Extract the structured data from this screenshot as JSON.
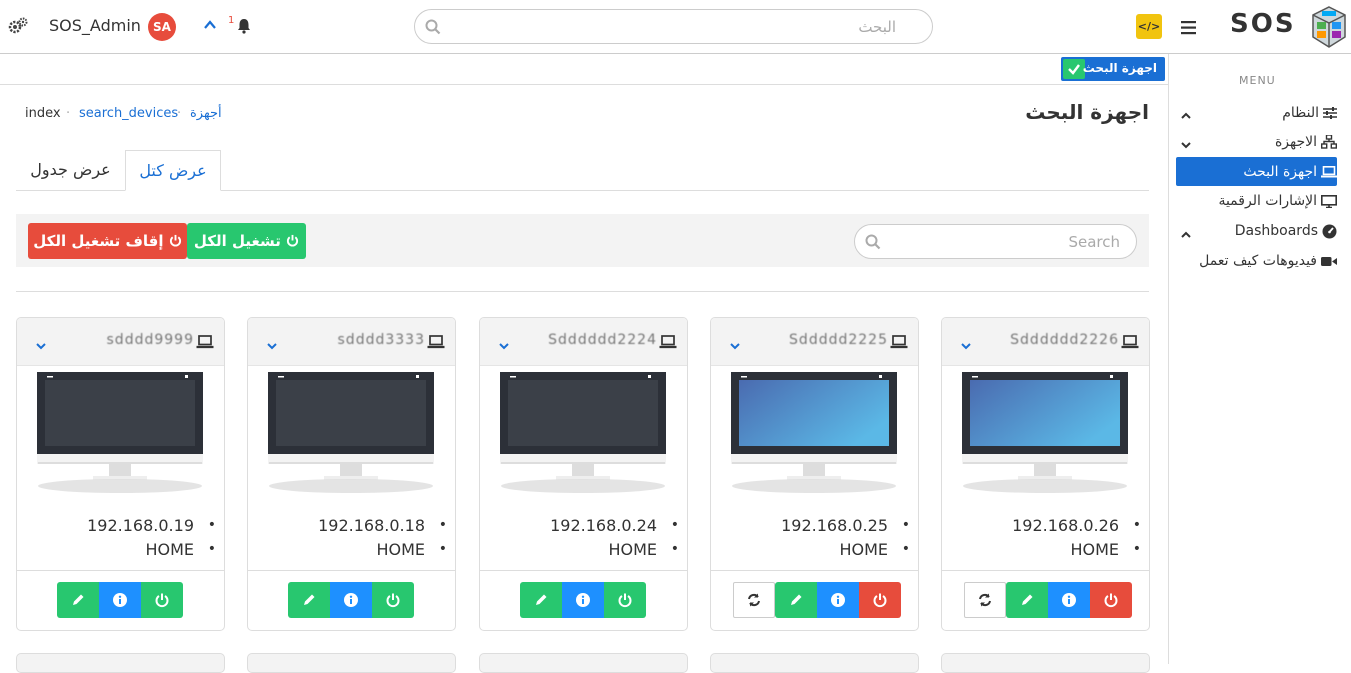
{
  "topbar": {
    "user_name": "SOS_Admin",
    "avatar_initials": "SA",
    "notification_count": "1",
    "search_placeholder": "البحث",
    "logo_text": "SOS"
  },
  "page_tag": "اجهزة البحث",
  "breadcrumb": [
    "index",
    "search_devices",
    "أجهزة"
  ],
  "page_title": "اجهزة البحث",
  "tabs": [
    {
      "label": "عرض كتل",
      "active": true
    },
    {
      "label": "عرض جدول",
      "active": false
    }
  ],
  "toolbar": {
    "stop_all": "إقاف تشغيل الكل",
    "start_all": "تشغيل الكل",
    "search_placeholder": "Search"
  },
  "devices": [
    {
      "name": "Sdddddd2226",
      "ip": "192.168.0.26",
      "location": "HOME",
      "active": true
    },
    {
      "name": "Sddddd2225",
      "ip": "192.168.0.25",
      "location": "HOME",
      "active": true
    },
    {
      "name": "Sdddddd2224",
      "ip": "192.168.0.24",
      "location": "HOME",
      "active": false
    },
    {
      "name": "sdddd3333",
      "ip": "192.168.0.18",
      "location": "HOME",
      "active": false
    },
    {
      "name": "sdddd9999",
      "ip": "192.168.0.19",
      "location": "HOME",
      "active": false
    }
  ],
  "sidebar": {
    "menu_heading": "MENU",
    "items": [
      {
        "label": "النظام",
        "icon": "sliders-icon"
      },
      {
        "label": "الاجهزة",
        "icon": "network-icon"
      },
      {
        "label": "اجهزة البحث",
        "icon": "laptop-icon",
        "active": true
      },
      {
        "label": "الإشارات الرقمية",
        "icon": "monitor-icon"
      },
      {
        "label": "Dashboards",
        "icon": "gauge-icon"
      },
      {
        "label": "فيديوهات كيف تعمل",
        "icon": "video-icon"
      }
    ]
  },
  "colors": {
    "primary": "#1a6fd4",
    "success": "#28c76f",
    "danger": "#e74c3c",
    "info": "#1e90ff",
    "warning": "#f1c40f"
  }
}
